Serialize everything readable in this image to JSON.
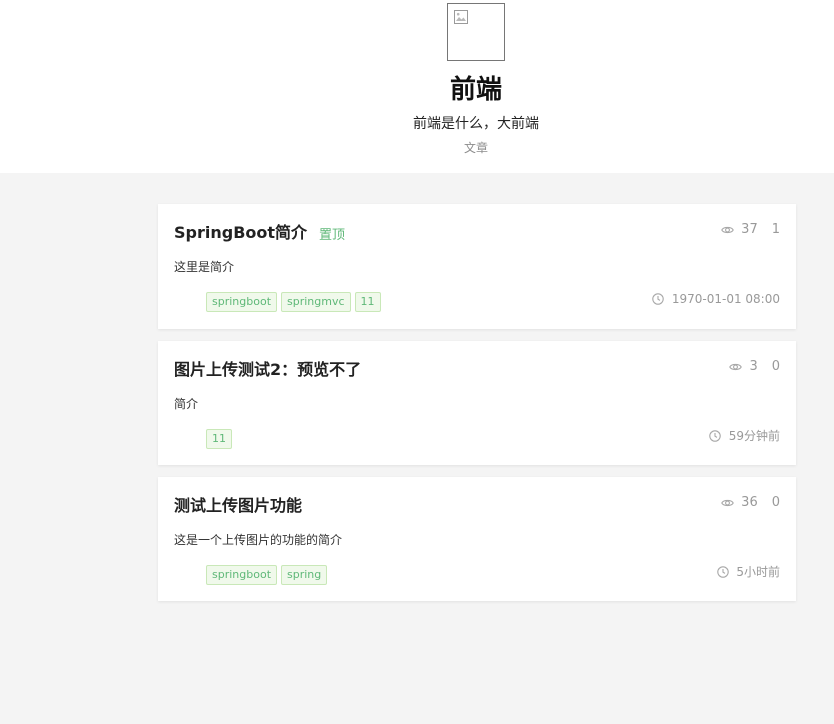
{
  "category": {
    "title": "前端",
    "description": "前端是什么，大前端",
    "subtitle": "文章",
    "cover_icon": "broken-image-icon"
  },
  "articles": [
    {
      "title": "SpringBoot简介",
      "pinned_label": "置顶",
      "views": "37",
      "comments": "1",
      "summary": "这里是简介",
      "tags": [
        "springboot",
        "springmvc",
        "11"
      ],
      "time": "1970-01-01 08:00"
    },
    {
      "title": "图片上传测试2：预览不了",
      "pinned_label": "",
      "views": "3",
      "comments": "0",
      "summary": "简介",
      "tags": [
        "11"
      ],
      "time": "59分钟前"
    },
    {
      "title": "测试上传图片功能",
      "pinned_label": "",
      "views": "36",
      "comments": "0",
      "summary": "这是一个上传图片的功能的简介",
      "tags": [
        "springboot",
        "spring"
      ],
      "time": "5小时前"
    }
  ],
  "colors": {
    "accent": "#5fb878",
    "page_bg": "#f4f4f4",
    "muted": "#999999"
  }
}
